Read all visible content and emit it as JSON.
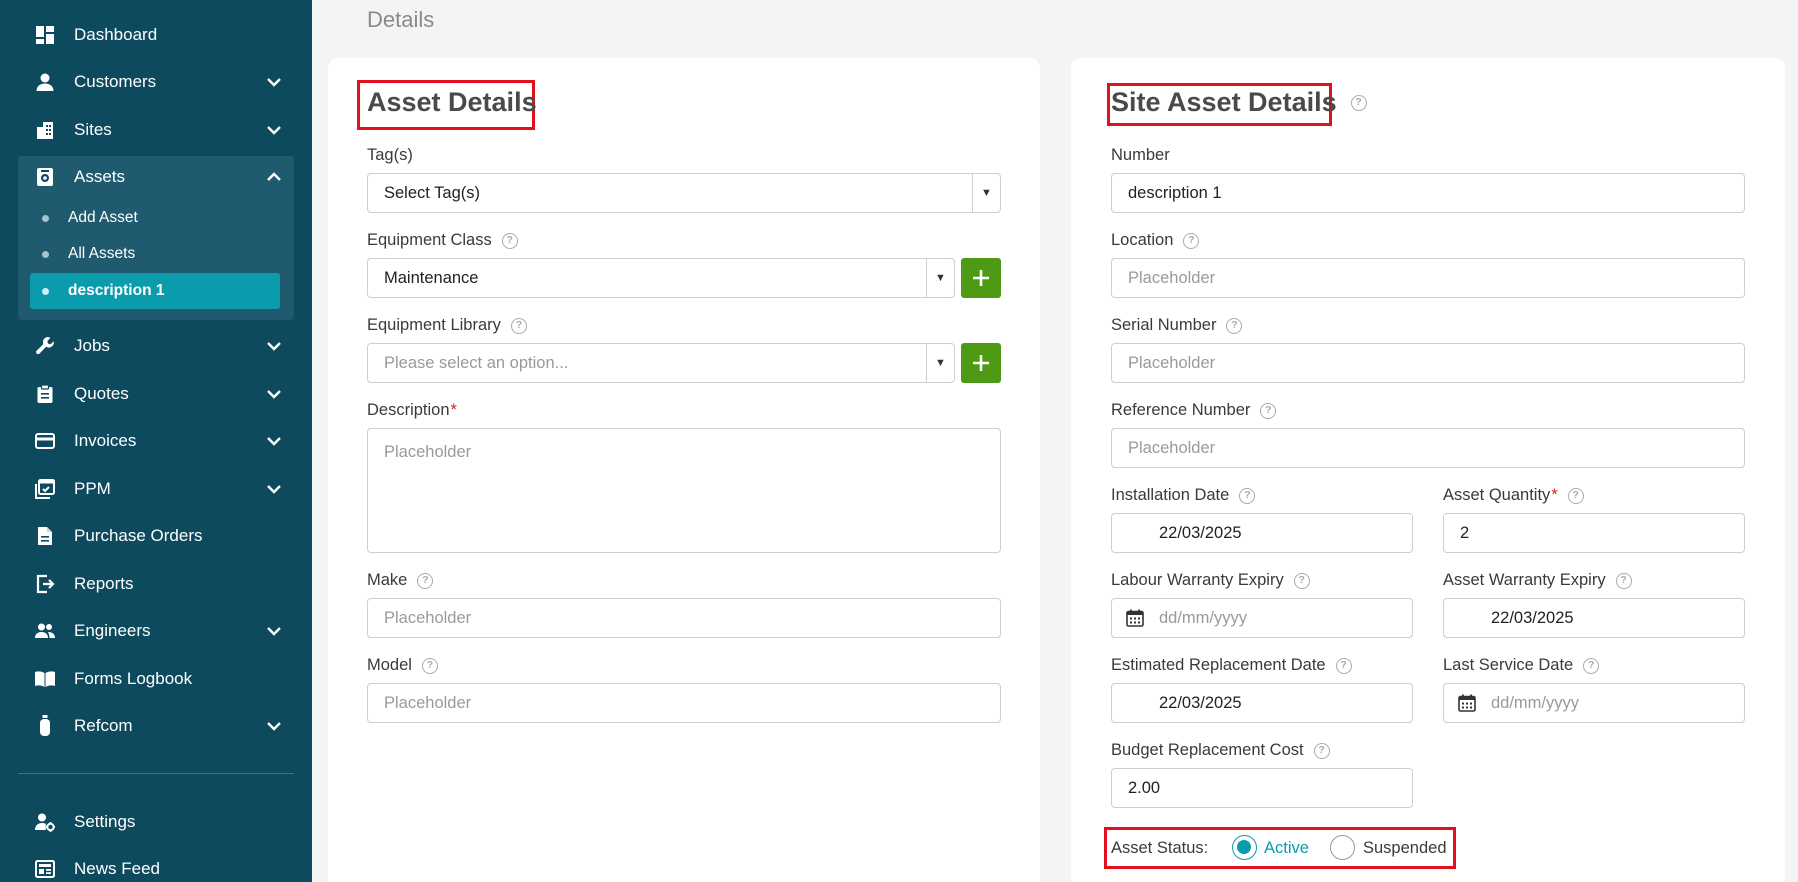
{
  "header": {
    "title": "Details"
  },
  "sidebar": {
    "items": [
      {
        "key": "dashboard",
        "label": "Dashboard",
        "icon": "dashboard-icon",
        "has_chevron": false
      },
      {
        "key": "customers",
        "label": "Customers",
        "icon": "person-icon",
        "has_chevron": true
      },
      {
        "key": "sites",
        "label": "Sites",
        "icon": "building-icon",
        "has_chevron": true
      },
      {
        "key": "assets",
        "label": "Assets",
        "icon": "asset-icon",
        "has_chevron": true,
        "expanded": true
      },
      {
        "key": "jobs",
        "label": "Jobs",
        "icon": "wrench-icon",
        "has_chevron": true
      },
      {
        "key": "quotes",
        "label": "Quotes",
        "icon": "clipboard-icon",
        "has_chevron": true
      },
      {
        "key": "invoices",
        "label": "Invoices",
        "icon": "card-icon",
        "has_chevron": true
      },
      {
        "key": "ppm",
        "label": "PPM",
        "icon": "calendar-check-icon",
        "has_chevron": true
      },
      {
        "key": "purchase-orders",
        "label": "Purchase Orders",
        "icon": "document-icon",
        "has_chevron": false
      },
      {
        "key": "reports",
        "label": "Reports",
        "icon": "export-icon",
        "has_chevron": false
      },
      {
        "key": "engineers",
        "label": "Engineers",
        "icon": "people-icon",
        "has_chevron": true
      },
      {
        "key": "forms-logbook",
        "label": "Forms Logbook",
        "icon": "book-icon",
        "has_chevron": false
      },
      {
        "key": "refcom",
        "label": "Refcom",
        "icon": "cylinder-icon",
        "has_chevron": true
      },
      {
        "key": "settings",
        "label": "Settings",
        "icon": "user-gear-icon",
        "has_chevron": false
      },
      {
        "key": "news-feed",
        "label": "News Feed",
        "icon": "newspaper-icon",
        "has_chevron": false
      }
    ],
    "assets_submenu": [
      {
        "label": "Add Asset",
        "active": false
      },
      {
        "label": "All Assets",
        "active": false
      },
      {
        "label": "description 1",
        "active": true
      }
    ]
  },
  "asset_details": {
    "title": "Asset Details",
    "tags": {
      "label": "Tag(s)",
      "value": "Select Tag(s)"
    },
    "equipment_class": {
      "label": "Equipment Class",
      "value": "Maintenance"
    },
    "equipment_library": {
      "label": "Equipment Library",
      "placeholder": "Please select an option..."
    },
    "description": {
      "label": "Description",
      "required_mark": "*",
      "placeholder": "Placeholder"
    },
    "make": {
      "label": "Make",
      "placeholder": "Placeholder"
    },
    "model": {
      "label": "Model",
      "placeholder": "Placeholder"
    }
  },
  "site_asset_details": {
    "title": "Site Asset Details",
    "number": {
      "label": "Number",
      "value": "description 1"
    },
    "location": {
      "label": "Location",
      "placeholder": "Placeholder"
    },
    "serial_number": {
      "label": "Serial Number",
      "placeholder": "Placeholder"
    },
    "reference_number": {
      "label": "Reference Number",
      "placeholder": "Placeholder"
    },
    "installation_date": {
      "label": "Installation Date",
      "value": "22/03/2025"
    },
    "asset_quantity": {
      "label": "Asset Quantity",
      "required_mark": "*",
      "value": "2"
    },
    "labour_warranty_expiry": {
      "label": "Labour Warranty Expiry",
      "placeholder": "dd/mm/yyyy"
    },
    "asset_warranty_expiry": {
      "label": "Asset Warranty Expiry",
      "value": "22/03/2025"
    },
    "estimated_replacement_date": {
      "label": "Estimated Replacement Date",
      "value": "22/03/2025"
    },
    "last_service_date": {
      "label": "Last Service Date",
      "placeholder": "dd/mm/yyyy"
    },
    "budget_replacement_cost": {
      "label": "Budget Replacement Cost",
      "value": "2.00"
    },
    "asset_status": {
      "label": "Asset Status:",
      "options": [
        {
          "label": "Active",
          "checked": true
        },
        {
          "label": "Suspended",
          "checked": false
        }
      ]
    }
  },
  "colors": {
    "sidebar_bg": "#0d4a5e",
    "sidebar_group_bg": "#1f5a6e",
    "active_teal": "#0a9cad",
    "add_button_green": "#4e9a14",
    "highlight_red": "#e0101e",
    "required_red": "#d3232a"
  }
}
